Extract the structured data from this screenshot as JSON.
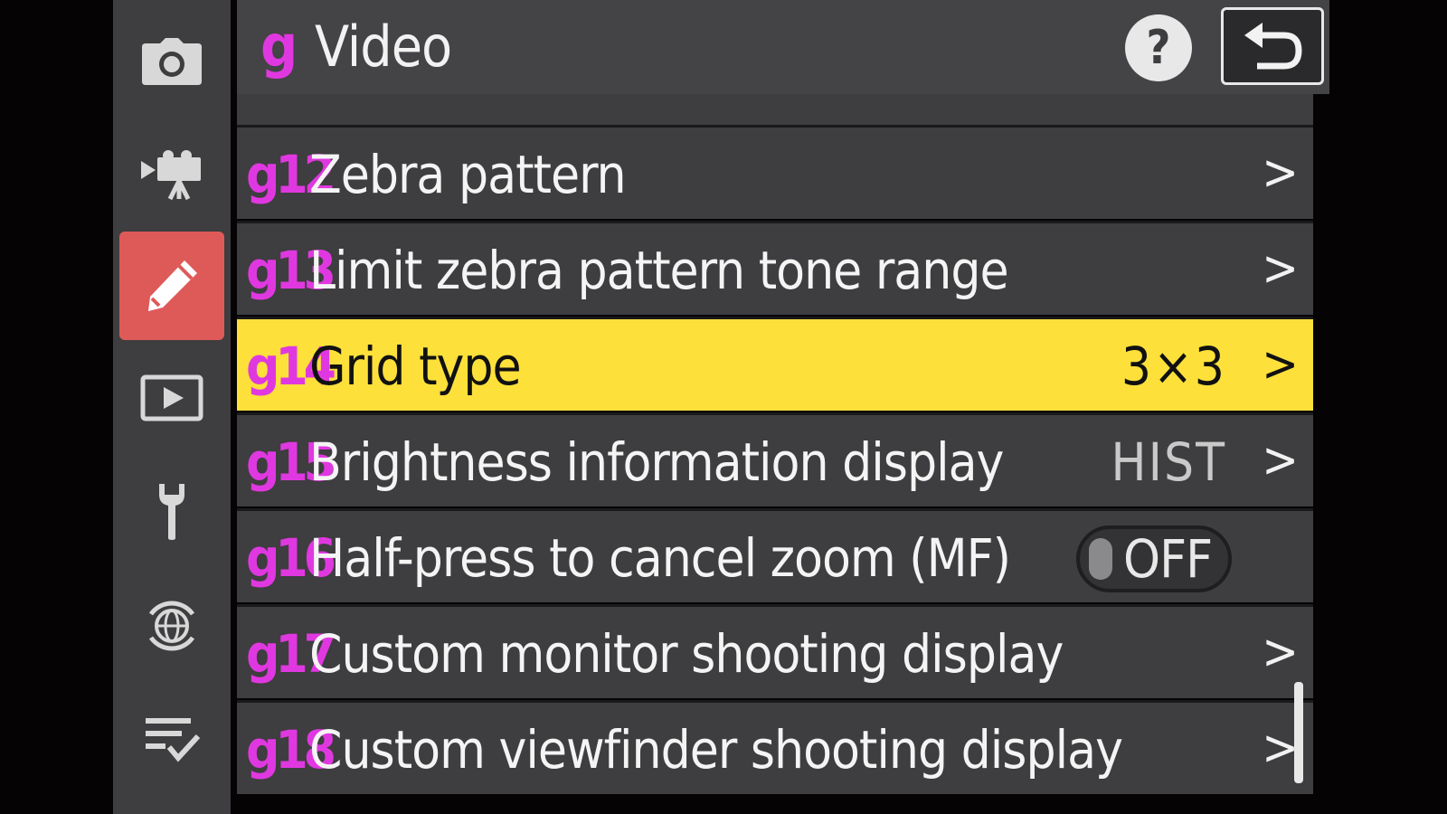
{
  "sidebar": {
    "items": [
      {
        "icon": "camera-icon",
        "active": false
      },
      {
        "icon": "movie-camera-icon",
        "active": false
      },
      {
        "icon": "pencil-icon",
        "active": true
      },
      {
        "icon": "playback-icon",
        "active": false
      },
      {
        "icon": "wrench-icon",
        "active": false
      },
      {
        "icon": "network-globe-icon",
        "active": false
      },
      {
        "icon": "my-menu-icon",
        "active": false
      }
    ],
    "active_color": "#de5a59"
  },
  "header": {
    "letter": "g",
    "title": "Video",
    "help_label": "?",
    "back_icon": "return-arrow-icon"
  },
  "menu": {
    "highlight_color": "#fde03a",
    "code_color": "#e038e0",
    "rows": [
      {
        "code": "g12",
        "label": "Zebra pattern",
        "value": "",
        "control": "chevron"
      },
      {
        "code": "g13",
        "label": "Limit zebra pattern tone range",
        "value": "",
        "control": "chevron"
      },
      {
        "code": "g14",
        "label": "Grid type",
        "value": "3×3",
        "control": "chevron",
        "selected": true
      },
      {
        "code": "g15",
        "label": "Brightness information display",
        "value": "HIST",
        "control": "chevron"
      },
      {
        "code": "g16",
        "label": "Half-press to cancel zoom (MF)",
        "value": "OFF",
        "control": "toggle"
      },
      {
        "code": "g17",
        "label": "Custom monitor shooting display",
        "value": "",
        "control": "chevron"
      },
      {
        "code": "g18",
        "label": "Custom viewfinder shooting display",
        "value": "",
        "control": "chevron"
      }
    ]
  }
}
